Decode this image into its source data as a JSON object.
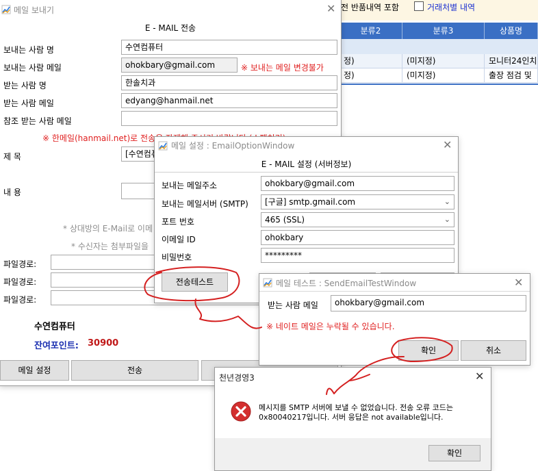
{
  "background": {
    "options": {
      "include_return_label": "전 반품내역 포함",
      "by_partner_label": "거래처별 내역"
    },
    "grid": {
      "headers": [
        "분류2",
        "분류3",
        "상품명"
      ],
      "rows": [
        [
          "정)",
          "(미지정)",
          "모니터24인치"
        ],
        [
          "정)",
          "(미지정)",
          "출장 점검 및 "
        ]
      ]
    }
  },
  "mail_window": {
    "title": "메일 보내기",
    "header": "E - MAIL 전송",
    "sender_name_label": "보내는 사람 명",
    "sender_name": "수연컴퓨터",
    "sender_email_label": "보내는 사람 메일",
    "sender_email": "ohokbary@gmail.com",
    "sender_email_note": "※ 보내는 메일 변경불가",
    "recipient_name_label": "받는 사람 명",
    "recipient_name": "한솔치과",
    "recipient_email_label": "받는 사람 메일",
    "recipient_email": "edyang@hanmail.net",
    "cc_label": "참조 받는 사람 메일",
    "cc_value": "",
    "hanmail_warning": "※ 한메일(hanmail.net)로 전송을 자제해 주시기 바랍니다.(스팸처리)",
    "subject_label": "제 목",
    "subject_value": "[수연컴퓨터",
    "content_label": "내 용",
    "hint1": "* 상대방의 E-Mail로 이메",
    "hint2": "* 수신자는 첨부파일을",
    "file_path_label": "파일경로:",
    "company_name": "수연컴퓨터",
    "points_label": "잔여포인트:",
    "points_value": "30900",
    "btn_mail_settings": "메일 설정",
    "btn_send": "전송"
  },
  "options_window": {
    "title": "메일 설정 : EmailOptionWindow",
    "header": "E - MAIL 설정 (서버정보)",
    "sender_address_label": "보내는 메일주소",
    "sender_address": "ohokbary@gmail.com",
    "smtp_label": "보내는 메일서버 (SMTP)",
    "smtp_value": "[구글] smtp.gmail.com",
    "port_label": "포트 번호",
    "port_value": "465 (SSL)",
    "email_id_label": "이메일 ID",
    "email_id": "ohokbary",
    "password_label": "비밀번호",
    "password": "*********",
    "btn_send_test": "전송테스트"
  },
  "test_window": {
    "title": "메일 테스트 : SendEmailTestWindow",
    "recipient_label": "받는 사람 메일",
    "recipient_email": "ohokbary@gmail.com",
    "warning": "※ 네이트 메일은 누락될 수 있습니다.",
    "btn_confirm": "확인",
    "btn_cancel": "취소"
  },
  "error_dialog": {
    "title": "천년경영3",
    "message_line1": "메시지를 SMTP 서버에 보낼 수 없었습니다. 전송 오류 코드는",
    "message_line2": "0x80040217입니다. 서버 응답은 not available입니다.",
    "btn_ok": "확인"
  },
  "colors": {
    "grid_header": "#3a6fc4",
    "warning_red": "#e02020",
    "points_blue": "#1a2fb0",
    "points_value_red": "#c01818",
    "annotation_red": "#d42020"
  }
}
